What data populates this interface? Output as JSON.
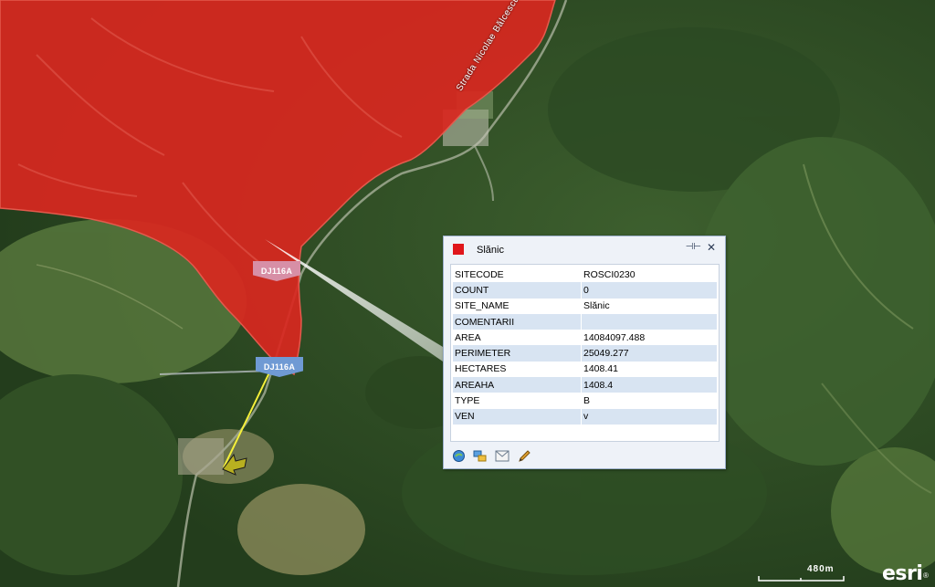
{
  "map": {
    "street_label": "Strada Nicolae Bălcescu",
    "road_shields": [
      "DJ116A",
      "DJ116A"
    ],
    "scale_label": "480m",
    "attribution": "esri",
    "polygon_color": "#d9271f",
    "leader_line_color": "#f5f03a"
  },
  "popup": {
    "title": "Slănic",
    "swatch_color": "#e0161b",
    "fields": [
      {
        "key": "SITECODE",
        "value": "ROSCI0230"
      },
      {
        "key": "COUNT",
        "value": "0"
      },
      {
        "key": "SITE_NAME",
        "value": "Slănic"
      },
      {
        "key": "COMENTARII",
        "value": ""
      },
      {
        "key": "AREA",
        "value": "14084097.488"
      },
      {
        "key": "PERIMETER",
        "value": "25049.277"
      },
      {
        "key": "HECTARES",
        "value": "1408.41"
      },
      {
        "key": "AREAHA",
        "value": "1408.4"
      },
      {
        "key": "TYPE",
        "value": "B"
      },
      {
        "key": "VEN",
        "value": "v"
      }
    ],
    "tools": [
      "zoom-to-icon",
      "layers-icon",
      "email-icon",
      "edit-pencil-icon"
    ]
  }
}
